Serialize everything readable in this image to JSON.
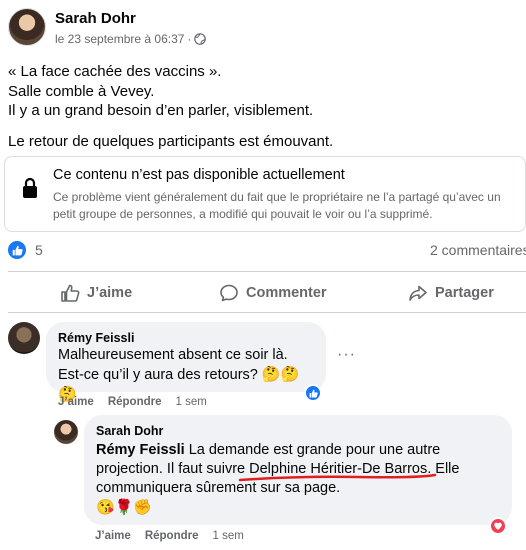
{
  "post": {
    "author": "Sarah Dohr",
    "date": "le 23 septembre à 06:37",
    "separator": "·",
    "more": "···",
    "lines": [
      "« La face cachée des vaccins ».",
      "Salle comble à Vevey.",
      "Il y a un grand besoin d’en parler, visiblement.",
      "Le retour de quelques participants est émouvant."
    ]
  },
  "unavailable": {
    "title": "Ce contenu n’est pas disponible actuellement",
    "description": "Ce problème vient généralement du fait que le propriétaire ne l’a partagé qu’avec un petit groupe de personnes, a modifié qui pouvait le voir ou l’a supprimé."
  },
  "stats": {
    "reactions": "5",
    "comments": "2 commentaires"
  },
  "actions": {
    "like": "J’aime",
    "comment": "Commenter",
    "share": "Partager"
  },
  "comments": [
    {
      "author": "Rémy Feissli",
      "text_line1": "Malheureusement absent ce soir là.",
      "text_line2": "Est-ce qu’il y aura des retours?",
      "emojis": "🤔🤔🤔",
      "like": "J’aime",
      "reply": "Répondre",
      "time": "1 sem",
      "more": "···"
    },
    {
      "author": "Sarah Dohr",
      "mention": "Rémy Feissli",
      "text_a": " La demande est grande pour une autre",
      "text_b": "projection. Il faut suivre ",
      "mention2": "Delphine Héritier-De Barros",
      "text_c": ". Elle",
      "text_d": "communiquera sûrement sur sa page.",
      "emojis": "😘🌹✊",
      "like": "J’aime",
      "reply": "Répondre",
      "time": "1 sem"
    }
  ],
  "colors": {
    "accent": "#1877f2",
    "secondary_text": "#65676b",
    "bubble": "#f0f2f5",
    "annotation": "#e02020",
    "love": "#f33e58"
  }
}
